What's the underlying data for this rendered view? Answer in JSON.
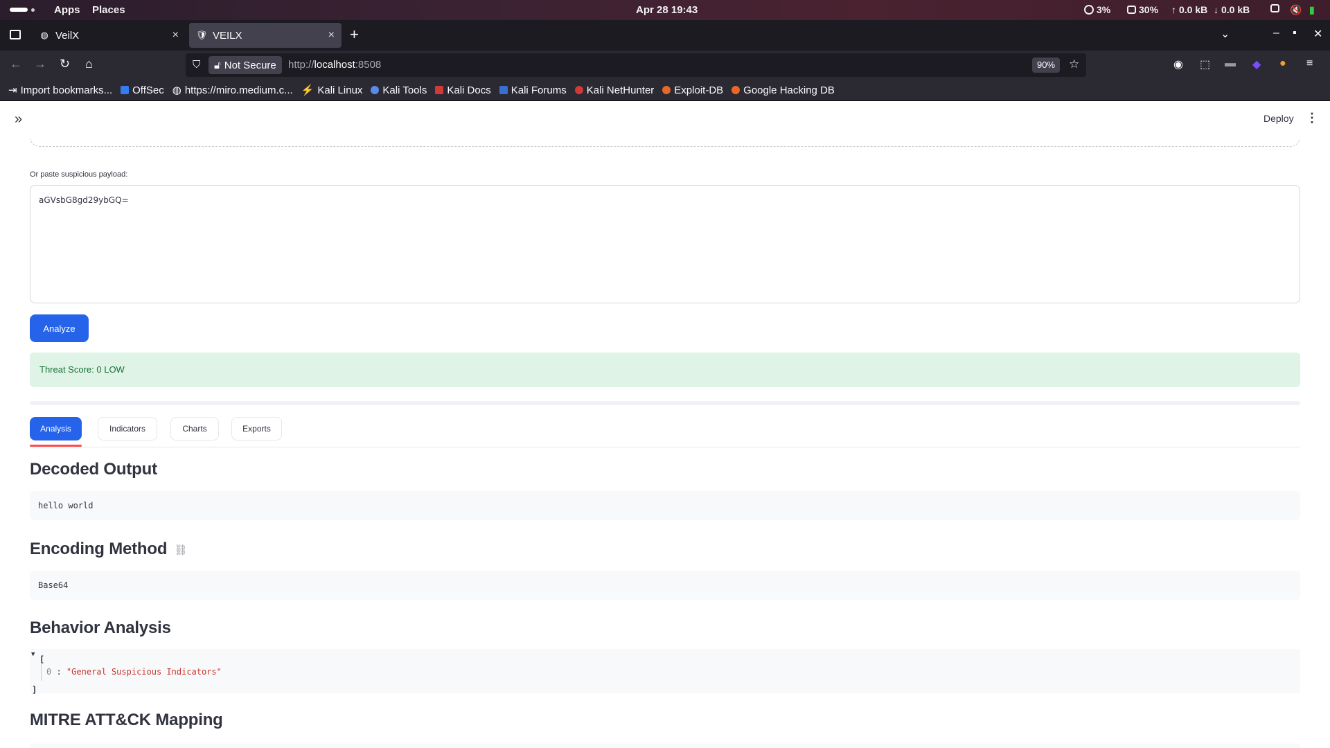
{
  "system_bar": {
    "apps": "Apps",
    "places": "Places",
    "clock": "Apr 28  19:43",
    "cpu": "3%",
    "memory": "30%",
    "upload": "0.0 kB",
    "download": "0.0 kB"
  },
  "browser": {
    "tabs": [
      {
        "title": "VeilX",
        "icon": "globe-icon",
        "active": false
      },
      {
        "title": "VEILX",
        "icon": "shield-icon",
        "active": true
      }
    ],
    "close_glyph": "×",
    "new_tab_glyph": "+",
    "security_label": "Not Secure",
    "url_prefix": "http://",
    "url_host": "localhost",
    "url_port": ":8508",
    "zoom": "90%",
    "bookmarks": [
      {
        "label": "Import bookmarks...",
        "icon": "import-icon",
        "color": "#fbfbfe"
      },
      {
        "label": "OffSec",
        "icon": "offsec-icon",
        "color": "#367bf0"
      },
      {
        "label": "https://miro.medium.c...",
        "icon": "globe-icon",
        "color": "#fbfbfe"
      },
      {
        "label": "Kali Linux",
        "icon": "kali-icon",
        "color": "#dddddd"
      },
      {
        "label": "Kali Tools",
        "icon": "kali-tools-icon",
        "color": "#5a8be8"
      },
      {
        "label": "Kali Docs",
        "icon": "kali-docs-icon",
        "color": "#d23a3a"
      },
      {
        "label": "Kali Forums",
        "icon": "kali-forums-icon",
        "color": "#3a6fd2"
      },
      {
        "label": "Kali NetHunter",
        "icon": "nethunter-icon",
        "color": "#d23a3a"
      },
      {
        "label": "Exploit-DB",
        "icon": "exploitdb-icon",
        "color": "#e8682a"
      },
      {
        "label": "Google Hacking DB",
        "icon": "ghdb-icon",
        "color": "#e8682a"
      }
    ]
  },
  "app": {
    "deploy_label": "Deploy",
    "payload_label": "Or paste suspicious payload:",
    "payload_value": "aGVsbG8gd29ybGQ=",
    "analyze_label": "Analyze",
    "threat_alert": "Threat Score: 0 LOW",
    "tabs": [
      "Analysis",
      "Indicators",
      "Charts",
      "Exports"
    ],
    "active_tab": "Analysis",
    "decoded_heading": "Decoded Output",
    "decoded_value": "hello world",
    "encoding_heading": "Encoding Method",
    "encoding_value": "Base64",
    "behavior_heading": "Behavior Analysis",
    "behavior_json": {
      "open": "[",
      "index": "0",
      "sep": " : ",
      "value": "\"General Suspicious Indicators\"",
      "close": "]"
    },
    "mitre_heading": "MITRE ATT&CK Mapping"
  },
  "colors": {
    "primary_button": "#2563eb",
    "active_tab_underline": "#ff4b4b",
    "success_bg": "#dff3e7",
    "success_text": "#177233"
  }
}
